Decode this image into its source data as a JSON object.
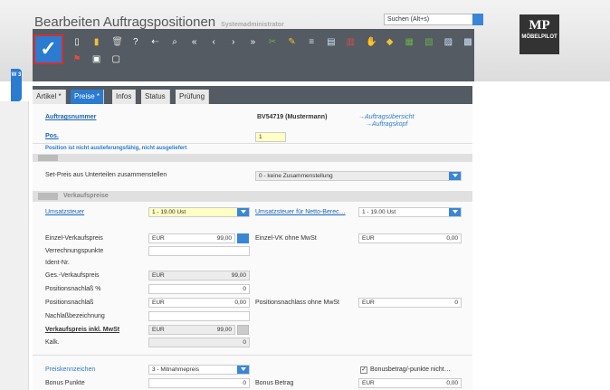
{
  "header": {
    "title": "Bearbeiten Auftragspositionen",
    "subtitle": "Systemadministrator",
    "search_value": "Suchen (Alt+s)"
  },
  "logo": {
    "big": "MP",
    "text": "MÖBELPILOT"
  },
  "side_tab": "W 3",
  "save_glyph": "✓",
  "toolbar_icons": [
    "new-icon",
    "folder-icon",
    "delete-icon",
    "help-icon",
    "back-icon",
    "search-icon",
    "first-icon",
    "prev-icon",
    "next-icon",
    "last-icon",
    "tool-icon",
    "pencil-icon",
    "list-icon",
    "document-icon",
    "document-arrow-icon",
    "handshake-icon",
    "tag-icon",
    "document-chart-icon",
    "document-export-icon",
    "document-text-icon",
    "document-edit-icon",
    "flags-icon",
    "calculator-icon",
    "document-small-icon"
  ],
  "tabs": [
    "Artikel *",
    "Preise *",
    "Infos",
    "Status",
    "Prüfung"
  ],
  "top": {
    "auftrag_label": "Auftragsnummer",
    "auftrag_value": "BV54719 (Mustermann)",
    "link1": "→Auftragsübersicht",
    "link2": "→Auftragskopf",
    "pos_label": "Pos.",
    "pos_value": "1",
    "warning": "Position ist nicht auslieferungsfähig, nicht ausgeliefert"
  },
  "set": {
    "label": "Set-Preis aus Unterteilen zusammenstellen",
    "value": "0 - keine Zusammenstellung"
  },
  "section_title": "Verkaufspreise",
  "ust": {
    "label": "Umsatzsteuer",
    "value": "1 - 19.00 Ust",
    "netto_label": "Umsatzsteuer für Netto-Berec…",
    "netto_value": "1 - 19.00 Ust"
  },
  "rows": {
    "ezvp": {
      "label": "Einzel-Verkaufspreis",
      "cur": "EUR",
      "val": "99,00"
    },
    "ezvk": {
      "label": "Einzel-VK ohne MwSt",
      "cur": "EUR",
      "val": "0,00"
    },
    "vrp": {
      "label": "Verrechnungspunkte"
    },
    "ident": {
      "label": "Ident-Nr."
    },
    "gvp": {
      "label": "Ges.-Verkaufspreis",
      "cur": "EUR",
      "val": "99,00"
    },
    "pnp": {
      "label": "Positionsnachlaß %",
      "val": "0"
    },
    "pn": {
      "label": "Positionsnachlaß",
      "cur": "EUR",
      "val": "0,00"
    },
    "pno": {
      "label": "Positionsnachlass ohne MwSt",
      "cur": "EUR",
      "val": "0"
    },
    "nb": {
      "label": "Nachlaßbezeichnung"
    },
    "vpi": {
      "label": "Verkaufspreis inkl. MwSt",
      "cur": "EUR",
      "val": "99,00"
    },
    "kalk": {
      "label": "Kalk.",
      "val": "0"
    }
  },
  "bottom": {
    "pk_label": "Preiskennzeichen",
    "pk_value": "3 - Mitnahmepreis",
    "bonus_check": "Bonusbetrag/-punkte nicht…",
    "bp_label": "Bonus Punkte",
    "bp_value": "0",
    "bb_label": "Bonus Betrag",
    "bb_cur": "EUR",
    "bb_value": "0,00"
  }
}
